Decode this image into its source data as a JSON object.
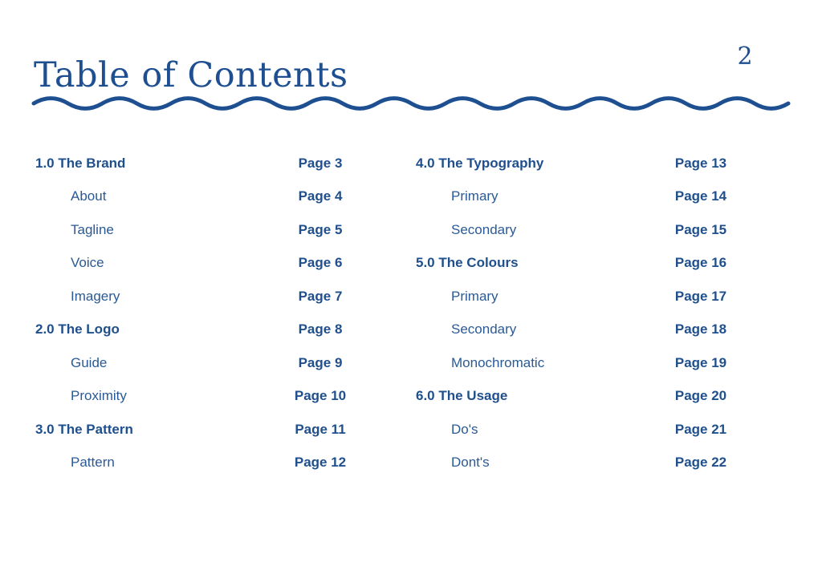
{
  "header": {
    "title": "Table of Contents",
    "page_number": "2"
  },
  "colors": {
    "primary": "#1d4f91"
  },
  "toc": {
    "left": [
      {
        "label": "1.0 The Brand",
        "page": "Page 3",
        "level": "section"
      },
      {
        "label": "About",
        "page": "Page 4",
        "level": "sub"
      },
      {
        "label": "Tagline",
        "page": "Page 5",
        "level": "sub"
      },
      {
        "label": "Voice",
        "page": "Page 6",
        "level": "sub"
      },
      {
        "label": "Imagery",
        "page": "Page 7",
        "level": "sub"
      },
      {
        "label": "2.0 The Logo",
        "page": "Page 8",
        "level": "section"
      },
      {
        "label": "Guide",
        "page": "Page 9",
        "level": "sub"
      },
      {
        "label": "Proximity",
        "page": "Page 10",
        "level": "sub"
      },
      {
        "label": "3.0 The Pattern",
        "page": "Page 11",
        "level": "section"
      },
      {
        "label": "Pattern",
        "page": "Page 12",
        "level": "sub"
      }
    ],
    "right": [
      {
        "label": "4.0 The Typography",
        "page": "Page 13",
        "level": "section"
      },
      {
        "label": "Primary",
        "page": "Page 14",
        "level": "sub"
      },
      {
        "label": "Secondary",
        "page": "Page 15",
        "level": "sub"
      },
      {
        "label": "5.0 The Colours",
        "page": "Page 16",
        "level": "section"
      },
      {
        "label": "Primary",
        "page": "Page 17",
        "level": "sub"
      },
      {
        "label": "Secondary",
        "page": "Page 18",
        "level": "sub"
      },
      {
        "label": "Monochromatic",
        "page": "Page 19",
        "level": "sub"
      },
      {
        "label": "6.0 The Usage",
        "page": "Page 20",
        "level": "section"
      },
      {
        "label": "Do's",
        "page": "Page 21",
        "level": "sub"
      },
      {
        "label": "Dont's",
        "page": "Page 22",
        "level": "sub"
      }
    ]
  }
}
